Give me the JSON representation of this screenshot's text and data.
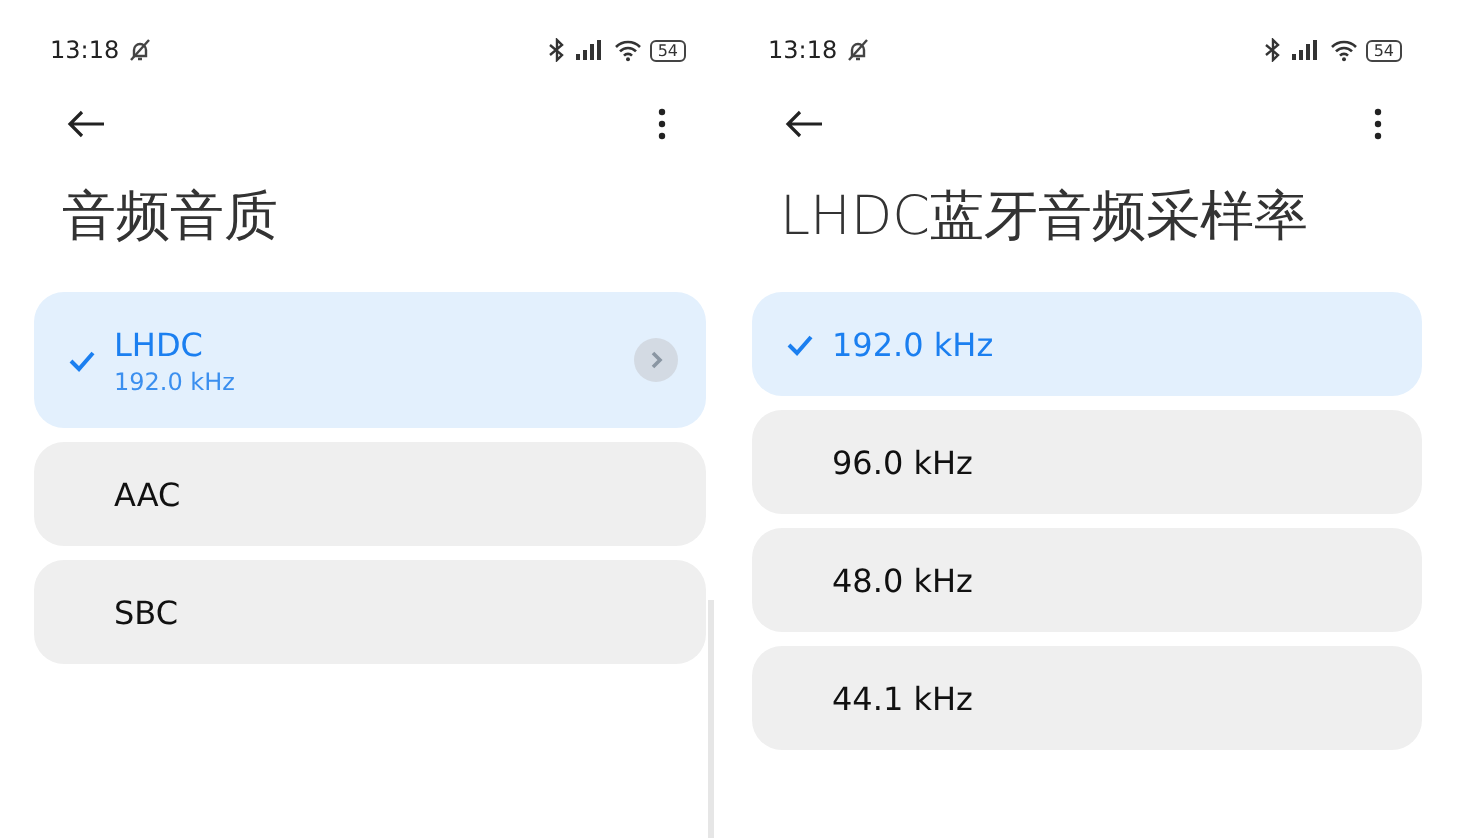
{
  "screens": [
    {
      "status_bar": {
        "time": "13:18",
        "battery": "54"
      },
      "title": "音频音质",
      "scrollbar": true,
      "options": [
        {
          "label": "LHDC",
          "detail": "192.0 kHz",
          "selected": true,
          "chevron": true
        },
        {
          "label": "AAC",
          "selected": false
        },
        {
          "label": "SBC",
          "selected": false
        }
      ]
    },
    {
      "status_bar": {
        "time": "13:18",
        "battery": "54"
      },
      "title": "LHDC蓝牙音频采样率",
      "options": [
        {
          "label": "192.0 kHz",
          "selected": true
        },
        {
          "label": "96.0 kHz",
          "selected": false
        },
        {
          "label": "48.0 kHz",
          "selected": false
        },
        {
          "label": "44.1 kHz",
          "selected": false
        }
      ]
    }
  ]
}
